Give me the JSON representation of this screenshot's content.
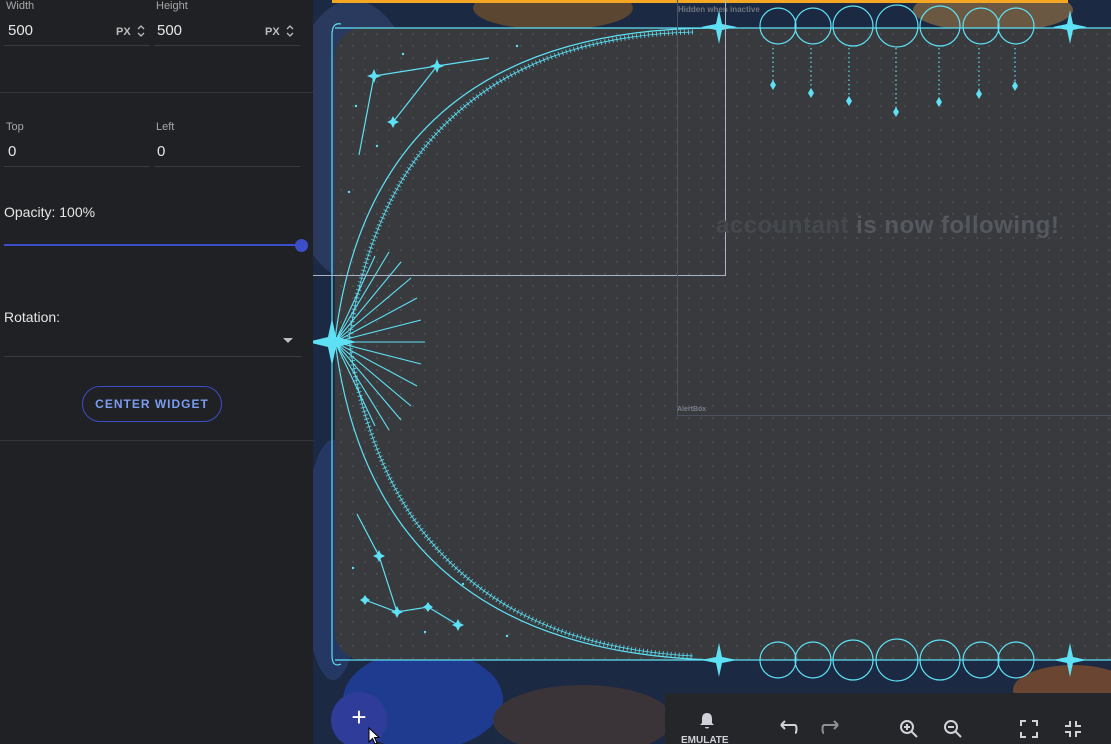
{
  "properties": {
    "width_label": "Width",
    "width_value": "500",
    "width_unit": "PX",
    "height_label": "Height",
    "height_value": "500",
    "height_unit": "PX",
    "top_label": "Top",
    "top_value": "0",
    "left_label": "Left",
    "left_value": "0",
    "opacity_label": "Opacity: 100%",
    "opacity_value": 1.0,
    "rotation_label": "Rotation:",
    "rotation_value": "",
    "center_button": "CENTER WIDGET"
  },
  "canvas": {
    "hidden_label": "Hidden when inactive",
    "alertbox_label": "AlertBox",
    "alert_name": "accountant",
    "alert_message": " is now following!",
    "accent_color": "#5ee1f5",
    "top_bar_color": "#f5a623"
  },
  "toolbar": {
    "add_button": "+",
    "emulate_label": "EMULATE",
    "icons": [
      "bell-icon",
      "undo-icon",
      "redo-icon",
      "zoom-in-icon",
      "zoom-out-icon",
      "fullscreen-icon",
      "exit-fullscreen-icon"
    ]
  }
}
